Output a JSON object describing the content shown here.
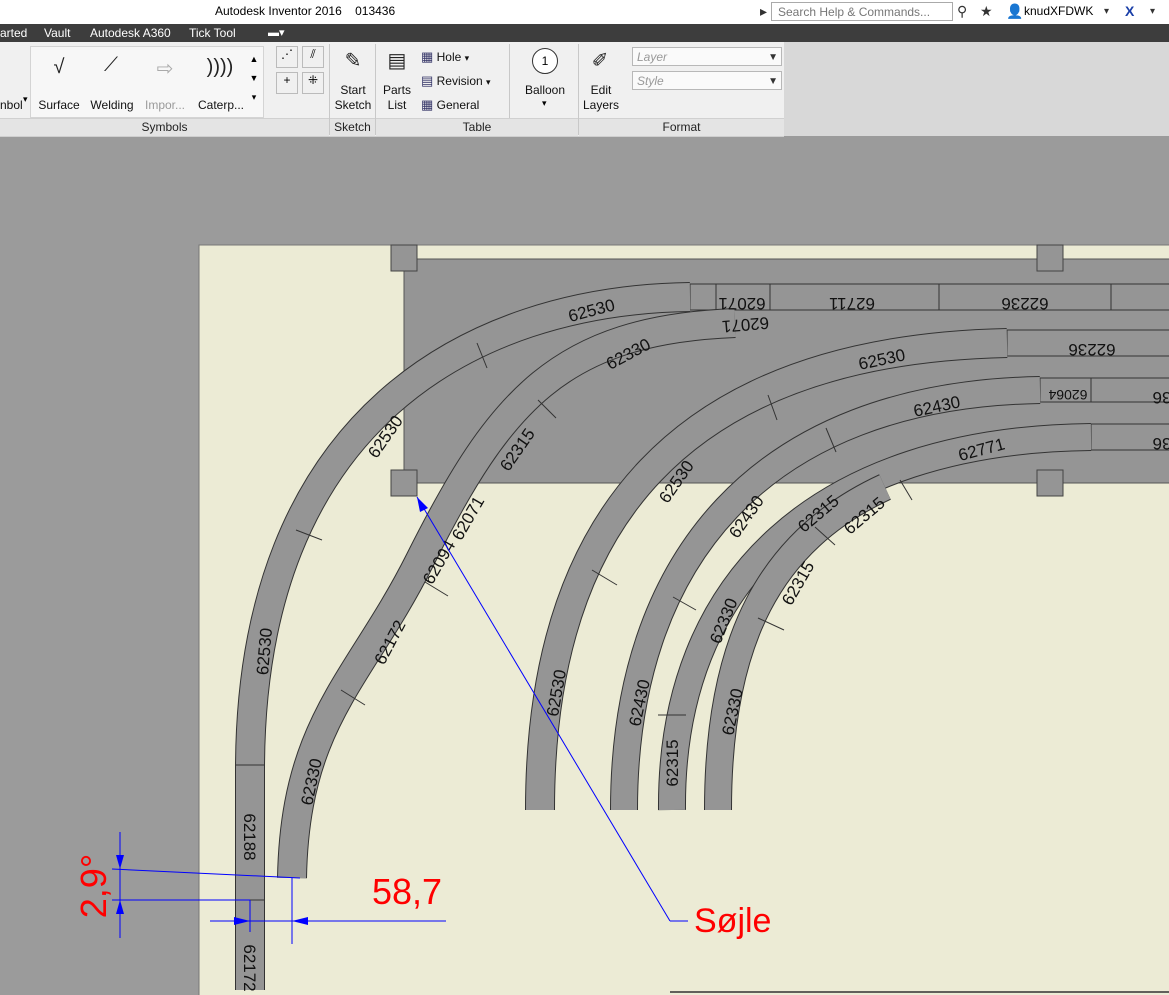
{
  "titlebar": {
    "title": "Autodesk Inventor 2016    013436",
    "search_placeholder": "Search Help & Commands...",
    "user": "knudXFDWK"
  },
  "menu": [
    "arted",
    "Vault",
    "Autodesk A360",
    "Tick Tool"
  ],
  "ribbon": {
    "symbols": {
      "left_cut_label": "nbol",
      "items": [
        "Surface",
        "Welding",
        "Impor...",
        "Caterp..."
      ],
      "panel": "Symbols"
    },
    "sketch": {
      "label1": "Start",
      "label2": "Sketch",
      "panel": "Sketch"
    },
    "table": {
      "parts1": "Parts",
      "parts2": "List",
      "hole": "Hole",
      "revision": "Revision",
      "general": "General",
      "panel": "Table"
    },
    "balloon": {
      "label": "Balloon",
      "number": "1"
    },
    "format": {
      "edit1": "Edit",
      "edit2": "Layers",
      "layer_placeholder": "Layer",
      "style_placeholder": "Style",
      "panel": "Format"
    }
  },
  "drawing": {
    "track_labels": [
      {
        "id": "l1",
        "text": "62530"
      },
      {
        "id": "l2",
        "text": "62071"
      },
      {
        "id": "l3",
        "text": "62711"
      },
      {
        "id": "l4",
        "text": "62236"
      },
      {
        "id": "l5",
        "text": "62330"
      },
      {
        "id": "l6",
        "text": "62071"
      },
      {
        "id": "l7",
        "text": "62236"
      },
      {
        "id": "l8",
        "text": "62530"
      },
      {
        "id": "l9",
        "text": "62064"
      },
      {
        "id": "l10",
        "text": "36"
      },
      {
        "id": "l11",
        "text": "62430"
      },
      {
        "id": "l12",
        "text": "36"
      },
      {
        "id": "l13",
        "text": "62530"
      },
      {
        "id": "l14",
        "text": "62315"
      },
      {
        "id": "l15",
        "text": "62771"
      },
      {
        "id": "l16",
        "text": "62071"
      },
      {
        "id": "l17",
        "text": "62094"
      },
      {
        "id": "l18",
        "text": "62530"
      },
      {
        "id": "l19",
        "text": "62315"
      },
      {
        "id": "l20",
        "text": "62315"
      },
      {
        "id": "l21",
        "text": "62430"
      },
      {
        "id": "l22",
        "text": "62315"
      },
      {
        "id": "l23",
        "text": "62530"
      },
      {
        "id": "l24",
        "text": "62172"
      },
      {
        "id": "l25",
        "text": "62330"
      },
      {
        "id": "l26",
        "text": "62530"
      },
      {
        "id": "l27",
        "text": "62430"
      },
      {
        "id": "l28",
        "text": "62330"
      },
      {
        "id": "l29",
        "text": "62330"
      },
      {
        "id": "l30",
        "text": "62315"
      },
      {
        "id": "l31",
        "text": "62188"
      },
      {
        "id": "l32",
        "text": "62172"
      }
    ],
    "dim_angle": "2,9°",
    "dim_length": "58,7",
    "callout": "Søjle"
  },
  "colors": {
    "canvas_bg": "#9b9b9b",
    "sheet": "#ecebd5",
    "track_fill": "#959595",
    "dimension_red": "#ff0000",
    "leader_blue": "#0000ff"
  }
}
